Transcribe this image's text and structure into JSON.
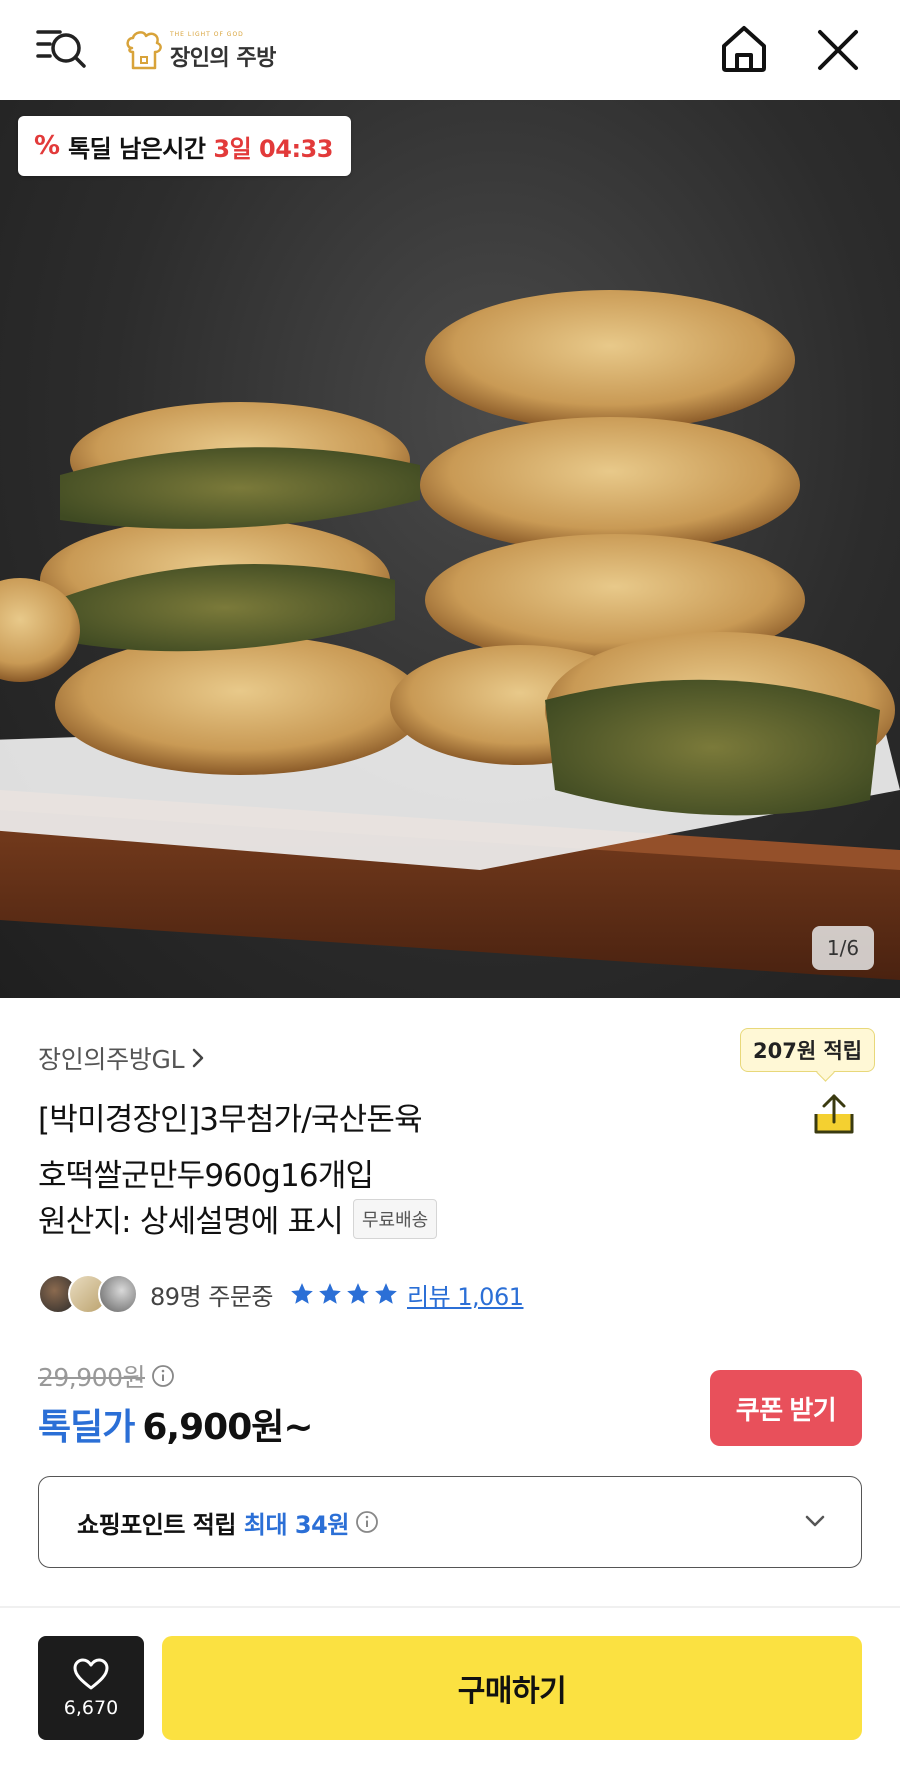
{
  "header": {
    "logo_small": "THE LIGHT OF GOD",
    "logo_text": "장인의 주방"
  },
  "hero": {
    "deal_timer_label": "톡딜 남은시간",
    "deal_timer_value": "3일 04:33",
    "image_counter": "1/6"
  },
  "product": {
    "seller": "장인의주방GL",
    "reward_badge": "207원 적립",
    "title_line1": "[박미경장인]3무첨가/국산돈육",
    "title_line2": "호떡쌀군만두960g16개입",
    "origin": "원산지: 상세설명에 표시",
    "shipping_badge": "무료배송",
    "orders": "89명 주문중",
    "rating_stars": 4,
    "review_link": "리뷰 1,061"
  },
  "price": {
    "original": "29,900원",
    "deal_label": "톡딜가",
    "deal_price": "6,900원~",
    "coupon_button": "쿠폰 받기"
  },
  "points": {
    "label": "쇼핑포인트 적립",
    "value": "최대 34원"
  },
  "bottom_bar": {
    "wish_count": "6,670",
    "buy_button": "구매하기"
  },
  "colors": {
    "accent_blue": "#2b6fd6",
    "deal_red": "#e23a3a",
    "coupon_red": "#e8505b",
    "buy_yellow": "#fbe141"
  },
  "icons": [
    "menu-search-icon",
    "chef-hat-logo-icon",
    "home-icon",
    "close-icon",
    "percent-icon",
    "chevron-right-icon",
    "share-icon",
    "star-icon",
    "info-icon",
    "chevron-down-icon",
    "heart-icon"
  ]
}
